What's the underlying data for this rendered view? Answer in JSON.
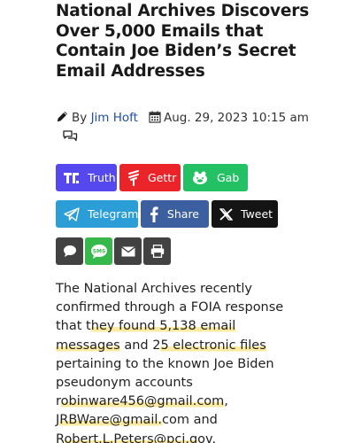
{
  "article": {
    "headline": "National Archives Discovers Over 5,000 Emails that Contain Joe Biden’s Secret Email Addresses",
    "byline": {
      "by_label": "By",
      "author": "Jim Hoft",
      "date": "Aug. 29, 2023 10:15 am"
    },
    "body": [
      {
        "text": "The National Archives recently confirmed through a FOIA response that t",
        "highlight": false
      },
      {
        "text": "hey found 5,138 email messages",
        "highlight": true
      },
      {
        "text": " and 2",
        "highlight": false
      },
      {
        "text": "5 electronic files",
        "highlight": true
      },
      {
        "text": " pertaining to the known Joe Biden pseudonym accounts r",
        "highlight": false
      },
      {
        "text": "obinware456@gmail.com",
        "highlight": true
      },
      {
        "text": ", J",
        "highlight": false
      },
      {
        "text": "RBWare@gmail.",
        "highlight": true
      },
      {
        "text": "com and R",
        "highlight": false
      },
      {
        "text": "obert.L.Peters@pci.g",
        "highlight": true
      },
      {
        "text": "ov.",
        "highlight": false
      }
    ]
  },
  "share_buttons": {
    "truth": {
      "label": "Truth",
      "color": "#5448ee"
    },
    "gettr": {
      "label": "Gettr",
      "color": "#ea2428"
    },
    "gab": {
      "label": "Gab",
      "color": "#24c164"
    },
    "telegram": {
      "label": "Telegram",
      "color": "#2b9ed7"
    },
    "share": {
      "label": "Share",
      "color": "#3c5f9f"
    },
    "tweet": {
      "label": "Tweet",
      "color": "#141414"
    }
  },
  "icons": [
    "pencil-icon",
    "calendar-icon",
    "comments-icon",
    "truth-social-icon",
    "gettr-icon",
    "gab-icon",
    "telegram-icon",
    "facebook-icon",
    "x-icon",
    "comment-share-icon",
    "sms-icon",
    "email-icon",
    "print-icon"
  ]
}
